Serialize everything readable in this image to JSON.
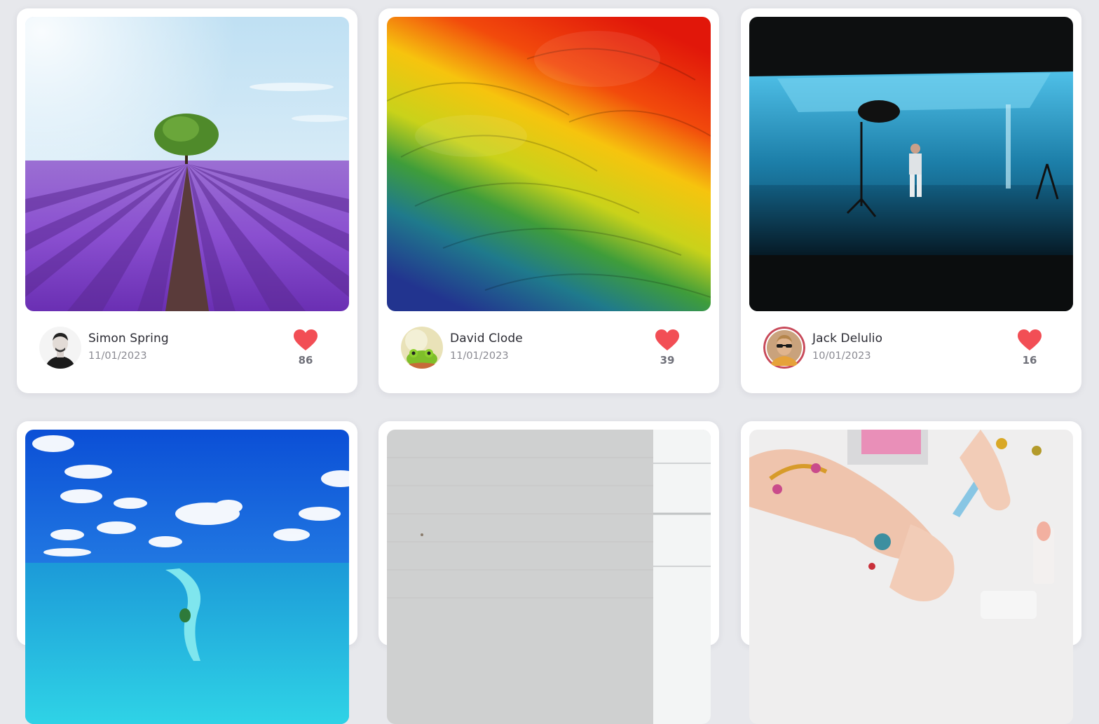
{
  "colors": {
    "page_background": "#e7e8ec",
    "card_background": "#ffffff",
    "heart": "#f24e55",
    "author_text": "#2b2b33",
    "date_text": "#8a8a92",
    "count_text": "#70717a"
  },
  "posts": [
    {
      "photo": "lavender-field-with-tree",
      "avatar": "man-portrait",
      "author": "Simon Spring",
      "date": "11/01/2023",
      "likes": "86",
      "like_icon": "heart-icon"
    },
    {
      "photo": "parrot-feathers",
      "avatar": "green-frog",
      "author": "David Clode",
      "date": "11/01/2023",
      "likes": "39",
      "like_icon": "heart-icon"
    },
    {
      "photo": "blue-photo-studio",
      "avatar": "man-sunglasses",
      "author": "Jack Delulio",
      "date": "10/01/2023",
      "likes": "16",
      "like_icon": "heart-icon"
    },
    {
      "photo": "ocean-island-sky"
    },
    {
      "photo": "white-brick-wall-room"
    },
    {
      "photo": "manicure-hands-jewelry"
    }
  ]
}
